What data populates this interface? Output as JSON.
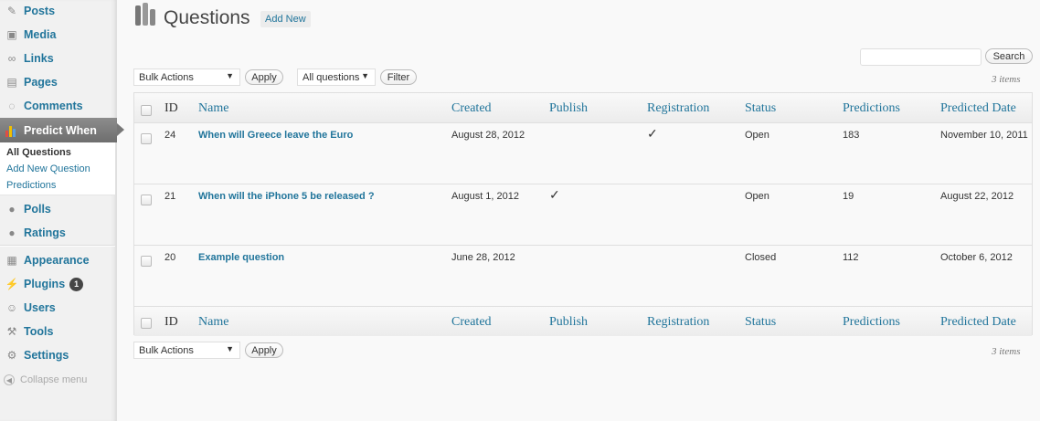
{
  "sidebar": {
    "items": [
      {
        "label": "Posts",
        "icon": "pin-icon"
      },
      {
        "label": "Media",
        "icon": "media-icon"
      },
      {
        "label": "Links",
        "icon": "link-icon"
      },
      {
        "label": "Pages",
        "icon": "pages-icon"
      },
      {
        "label": "Comments",
        "icon": "comment-icon"
      }
    ],
    "active": {
      "label": "Predict When",
      "icon": "chart-icon"
    },
    "submenu": [
      "All Questions",
      "Add New Question",
      "Predictions"
    ],
    "items2": [
      {
        "label": "Polls",
        "icon": "poll-icon"
      },
      {
        "label": "Ratings",
        "icon": "rating-icon"
      }
    ],
    "items3": [
      {
        "label": "Appearance",
        "icon": "appearance-icon"
      },
      {
        "label": "Plugins",
        "icon": "plugin-icon",
        "badge": "1"
      },
      {
        "label": "Users",
        "icon": "users-icon"
      },
      {
        "label": "Tools",
        "icon": "tools-icon"
      },
      {
        "label": "Settings",
        "icon": "settings-icon"
      }
    ],
    "collapse": "Collapse menu"
  },
  "header": {
    "title": "Questions",
    "add_new": "Add New"
  },
  "search": {
    "button": "Search",
    "value": ""
  },
  "toolbar_top": {
    "bulk": "Bulk Actions",
    "apply": "Apply",
    "filter_select": "All questions",
    "filter": "Filter",
    "count": "3 items"
  },
  "toolbar_bottom": {
    "bulk": "Bulk Actions",
    "apply": "Apply",
    "count": "3 items"
  },
  "table": {
    "columns": [
      "ID",
      "Name",
      "Created",
      "Publish",
      "Registration",
      "Status",
      "Predictions",
      "Predicted Date"
    ],
    "rows": [
      {
        "id": "24",
        "name": "When will Greece leave the Euro",
        "created": "August 28, 2012",
        "publish": "",
        "registration": "✓",
        "status": "Open",
        "predictions": "183",
        "predicted_date": "November 10, 2011"
      },
      {
        "id": "21",
        "name": "When will the iPhone 5 be released ?",
        "created": "August 1, 2012",
        "publish": "✓",
        "registration": "",
        "status": "Open",
        "predictions": "19",
        "predicted_date": "August 22, 2012"
      },
      {
        "id": "20",
        "name": "Example question",
        "created": "June 28, 2012",
        "publish": "",
        "registration": "",
        "status": "Closed",
        "predictions": "112",
        "predicted_date": "October 6, 2012"
      }
    ]
  },
  "colors": {
    "link": "#21759b",
    "active_menu": "#777777"
  }
}
